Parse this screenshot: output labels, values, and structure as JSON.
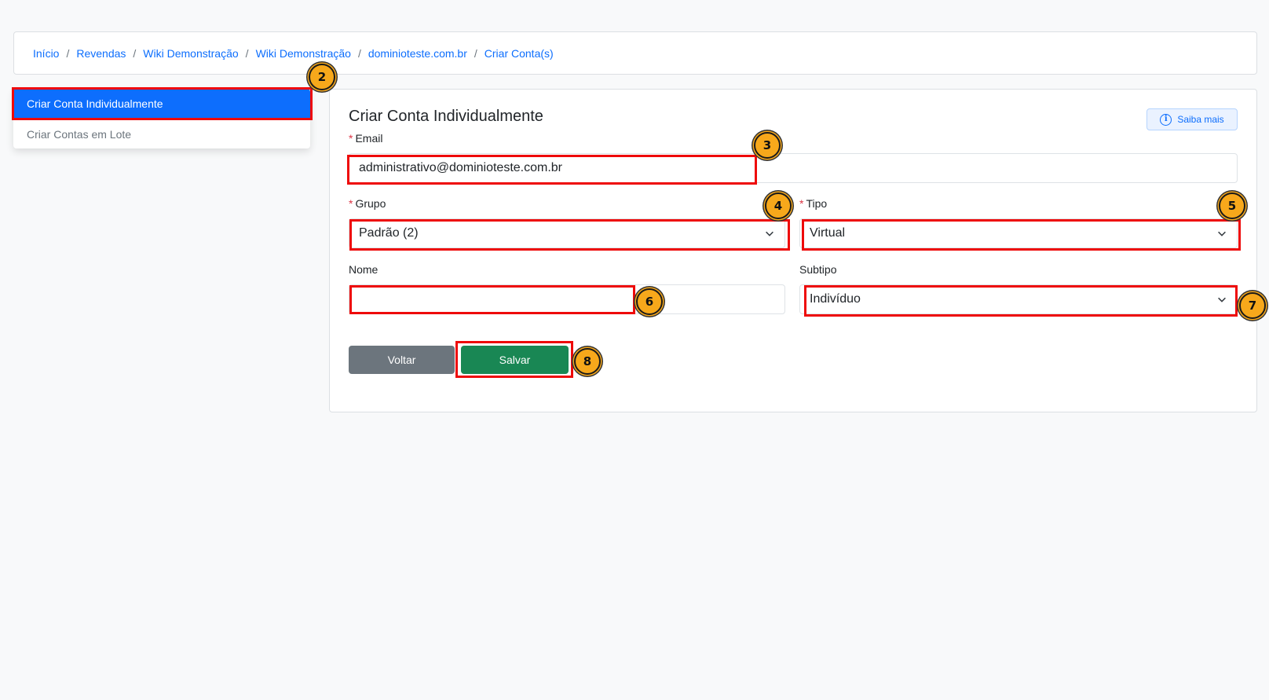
{
  "breadcrumb": [
    "Início",
    "Revendas",
    "Wiki Demonstração",
    "Wiki Demonstração",
    "dominioteste.com.br",
    "Criar Conta(s)"
  ],
  "breadcrumb_separator": "/",
  "sidebar": {
    "items": [
      {
        "label": "Criar Conta Individualmente",
        "active": true
      },
      {
        "label": "Criar Contas em Lote",
        "active": false
      }
    ]
  },
  "form": {
    "title": "Criar Conta Individualmente",
    "help_button": "Saiba mais",
    "required_mark": "*",
    "email": {
      "label": "Email",
      "value": "administrativo@dominioteste.com.br"
    },
    "grupo": {
      "label": "Grupo",
      "value": "Padrão (2)"
    },
    "tipo": {
      "label": "Tipo",
      "value": "Virtual"
    },
    "nome": {
      "label": "Nome",
      "value": ""
    },
    "subtipo": {
      "label": "Subtipo",
      "value": "Indivíduo"
    },
    "back_button": "Voltar",
    "save_button": "Salvar"
  },
  "annotations": {
    "badges": [
      "2",
      "3",
      "4",
      "5",
      "6",
      "7",
      "8"
    ],
    "highlight_color": "#ee0a0a",
    "badge_color": "#f7a81b"
  },
  "colors": {
    "primary": "#0d6efd",
    "success": "#198754",
    "secondary": "#6c757d",
    "danger": "#dc3545"
  }
}
